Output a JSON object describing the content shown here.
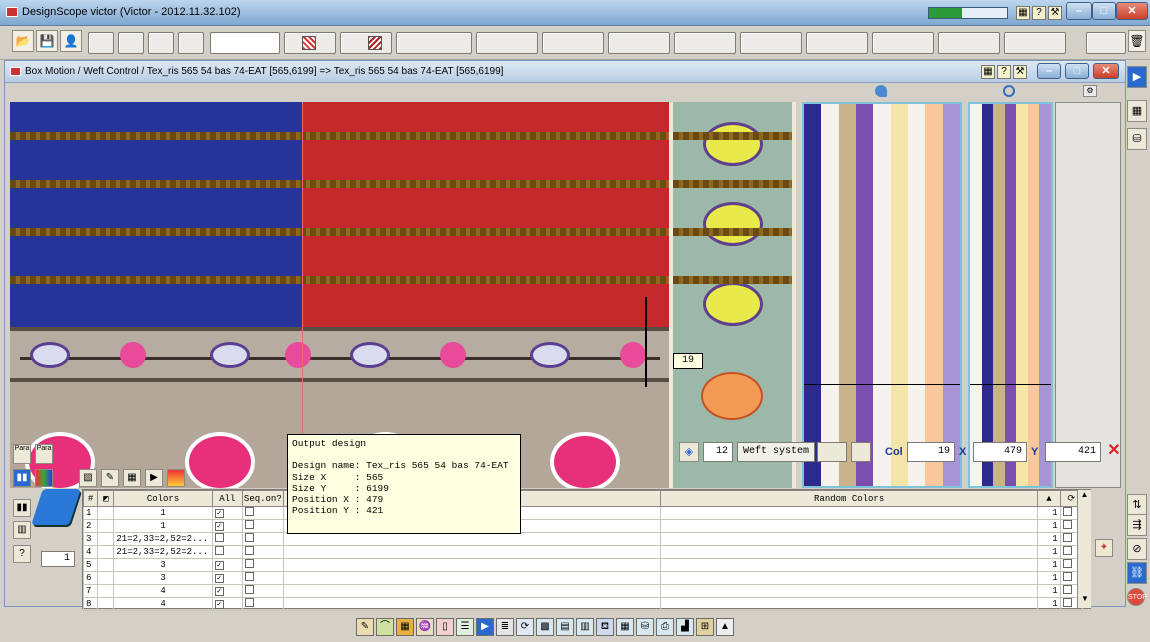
{
  "window": {
    "title": "DesignScope victor (Victor - 2012.11.32.102)",
    "accent_color": "#7fa7cf",
    "memory_usage_fraction": 0.42
  },
  "child_window": {
    "title": "Box Motion / Weft Control / Tex_ris 565 54 bas 74-EAT [565,6199] => Tex_ris 565 54 bas 74-EAT [565,6199]"
  },
  "canvas": {
    "crosshair_label": "19"
  },
  "coords": {
    "count_value": "12",
    "weft_system_label": "Weft system",
    "col_label": "Col",
    "col_value": "19",
    "x_label": "X",
    "x_value": "479",
    "y_label": "Y",
    "y_value": "421"
  },
  "side_panel": {
    "para_1": "Para",
    "para_2": "Para",
    "spinner_value": "1"
  },
  "tooltip": {
    "text": "Output design\n\nDesign name: Tex_ris 565 54 bas 74-EAT\nSize X     : 565\nSize Y     : 6199\nPosition X : 479\nPosition Y : 421"
  },
  "grid": {
    "headers": {
      "num": "#",
      "colors": "Colors",
      "all": "All",
      "seq": "Seq.on?",
      "random": "Random Colors"
    },
    "rows": [
      {
        "num": "1",
        "colors": "1",
        "all": true,
        "qty": "1"
      },
      {
        "num": "2",
        "colors": "1",
        "all": true,
        "qty": "1"
      },
      {
        "num": "3",
        "colors": "21=2,33=2,52=2...",
        "all": false,
        "qty": "1"
      },
      {
        "num": "4",
        "colors": "21=2,33=2,52=2...",
        "all": false,
        "qty": "1"
      },
      {
        "num": "5",
        "colors": "3",
        "all": true,
        "qty": "1"
      },
      {
        "num": "6",
        "colors": "3",
        "all": true,
        "qty": "1"
      },
      {
        "num": "7",
        "colors": "4",
        "all": true,
        "qty": "1"
      },
      {
        "num": "8",
        "colors": "4",
        "all": true,
        "qty": "1"
      }
    ]
  },
  "stripes": {
    "panel1": [
      "#2c2a8a",
      "#f6f3ef",
      "#c9b38a",
      "#7a4fb0",
      "#f6f3ef",
      "#f3e6a8",
      "#f6f3ef",
      "#f8c89a",
      "#a794d6"
    ],
    "panel2": [
      "#f6f3ef",
      "#2c2a8a",
      "#c9b38a",
      "#7a4fb0",
      "#f3e6a8",
      "#f8c89a",
      "#a794d6"
    ]
  }
}
